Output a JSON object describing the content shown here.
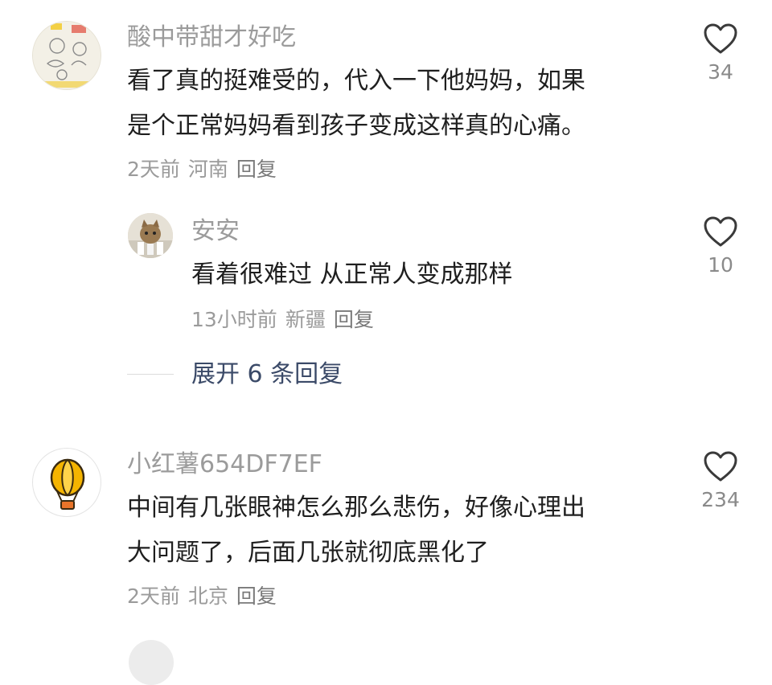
{
  "comments": [
    {
      "username": "酸中带甜才好吃",
      "lines": [
        "看了真的挺难受的，代入一下他妈妈，如果",
        "是个正常妈妈看到孩子变成这样真的心痛。"
      ],
      "time": "2天前",
      "location": "河南",
      "reply_label": "回复",
      "likes": "34",
      "avatar_icon": "sketch-avatar-icon"
    },
    {
      "username": "小红薯654DF7EF",
      "lines": [
        "中间有几张眼神怎么那么悲伤，好像心理出",
        "大问题了，后面几张就彻底黑化了"
      ],
      "time": "2天前",
      "location": "北京",
      "reply_label": "回复",
      "likes": "234",
      "avatar_icon": "hot-air-balloon-icon"
    }
  ],
  "reply": {
    "username": "安安",
    "text": "看着很难过 从正常人变成那样",
    "time": "13小时前",
    "location": "新疆",
    "reply_label": "回复",
    "likes": "10",
    "avatar_icon": "cat-photo-avatar-icon"
  },
  "expand": {
    "label": "展开 6 条回复"
  },
  "colors": {
    "username": "#9b9b9b",
    "text": "#1f1f1f",
    "link": "#3b4a68",
    "balloon": "#f5b400"
  }
}
